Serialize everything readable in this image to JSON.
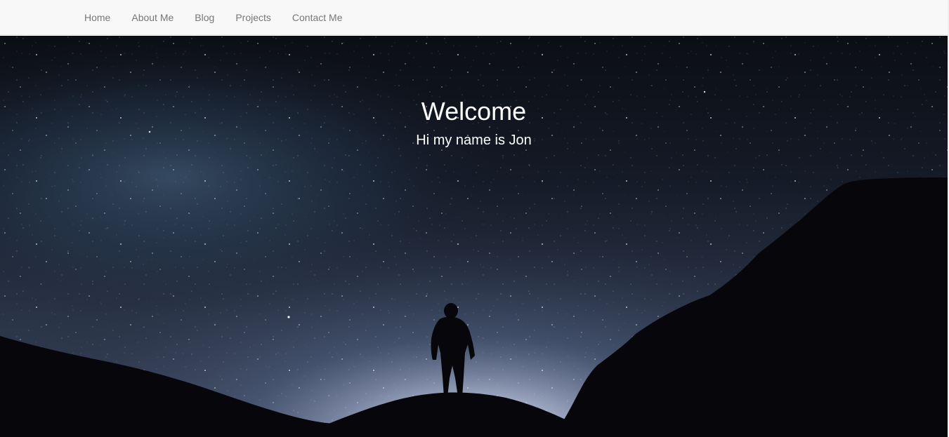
{
  "nav": {
    "items": [
      {
        "label": "Home"
      },
      {
        "label": "About Me"
      },
      {
        "label": "Blog"
      },
      {
        "label": "Projects"
      },
      {
        "label": "Contact Me"
      }
    ]
  },
  "hero": {
    "title": "Welcome",
    "subtitle": "Hi my name is Jon",
    "image_subject": "night sky with stars, silhouette of hiker on mountain ridge"
  },
  "colors": {
    "navbar_bg": "#f8f8f8",
    "nav_text": "#777777",
    "hero_text": "#ffffff",
    "sky_top": "#0d0f16",
    "sky_glow": "#c9cfe6",
    "silhouette": "#07060a"
  }
}
